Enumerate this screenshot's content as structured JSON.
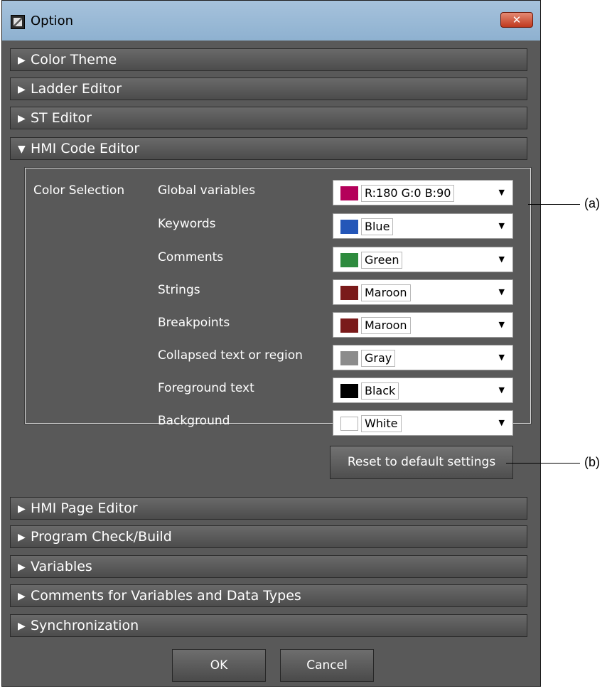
{
  "window": {
    "title": "Option",
    "close_label": "✕"
  },
  "sections_top": [
    {
      "label": "Color Theme",
      "arrow": "▶"
    },
    {
      "label": "Ladder Editor",
      "arrow": "▶"
    },
    {
      "label": "ST Editor",
      "arrow": "▶"
    },
    {
      "label": "HMI Code Editor",
      "arrow": "▼"
    }
  ],
  "hmi_code_editor": {
    "group_label": "Color Selection",
    "rows": [
      {
        "label": "Global variables",
        "value": "R:180 G:0 B:90",
        "color": "#b4005a"
      },
      {
        "label": "Keywords",
        "value": "Blue",
        "color": "#2456b8"
      },
      {
        "label": "Comments",
        "value": "Green",
        "color": "#2e8b3e"
      },
      {
        "label": "Strings",
        "value": "Maroon",
        "color": "#7a1a1a"
      },
      {
        "label": "Breakpoints",
        "value": "Maroon",
        "color": "#7a1a1a"
      },
      {
        "label": "Collapsed text or region",
        "value": "Gray",
        "color": "#8c8c8c"
      },
      {
        "label": "Foreground text",
        "value": "Black",
        "color": "#000000"
      },
      {
        "label": "Background",
        "value": "White",
        "color": "#ffffff"
      }
    ],
    "reset_label": "Reset to default settings"
  },
  "sections_bottom": [
    {
      "label": "HMI Page Editor",
      "arrow": "▶"
    },
    {
      "label": "Program Check/Build",
      "arrow": "▶"
    },
    {
      "label": "Variables",
      "arrow": "▶"
    },
    {
      "label": "Comments for Variables and Data Types",
      "arrow": "▶"
    },
    {
      "label": "Synchronization",
      "arrow": "▶"
    }
  ],
  "footer": {
    "ok_label": "OK",
    "cancel_label": "Cancel"
  },
  "callouts": {
    "a": "(a)",
    "b": "(b)"
  }
}
